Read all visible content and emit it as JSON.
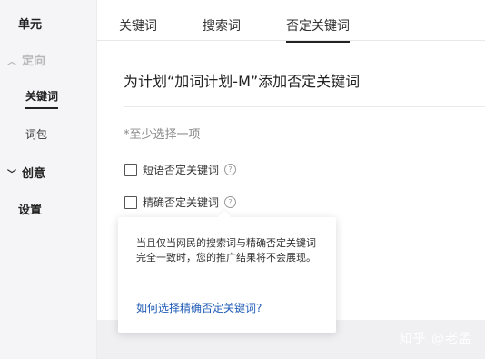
{
  "sidebar": {
    "unit": "单元",
    "targeting": "定向",
    "keywords": "关键词",
    "word_pack": "词包",
    "creative": "创意",
    "settings": "设置"
  },
  "tabs": [
    "关键词",
    "搜索词",
    "否定关键词"
  ],
  "main": {
    "heading": "为计划“加词计划-M”添加否定关键词",
    "hint": "*至少选择一项",
    "options": [
      "短语否定关键词",
      "精确否定关键词"
    ]
  },
  "popover": {
    "text": "当且仅当网民的搜索词与精确否定关键词完全一致时，您的推广结果将不会展现。",
    "link": "如何选择精确否定关键词?"
  },
  "watermark": "知乎 @老孟"
}
